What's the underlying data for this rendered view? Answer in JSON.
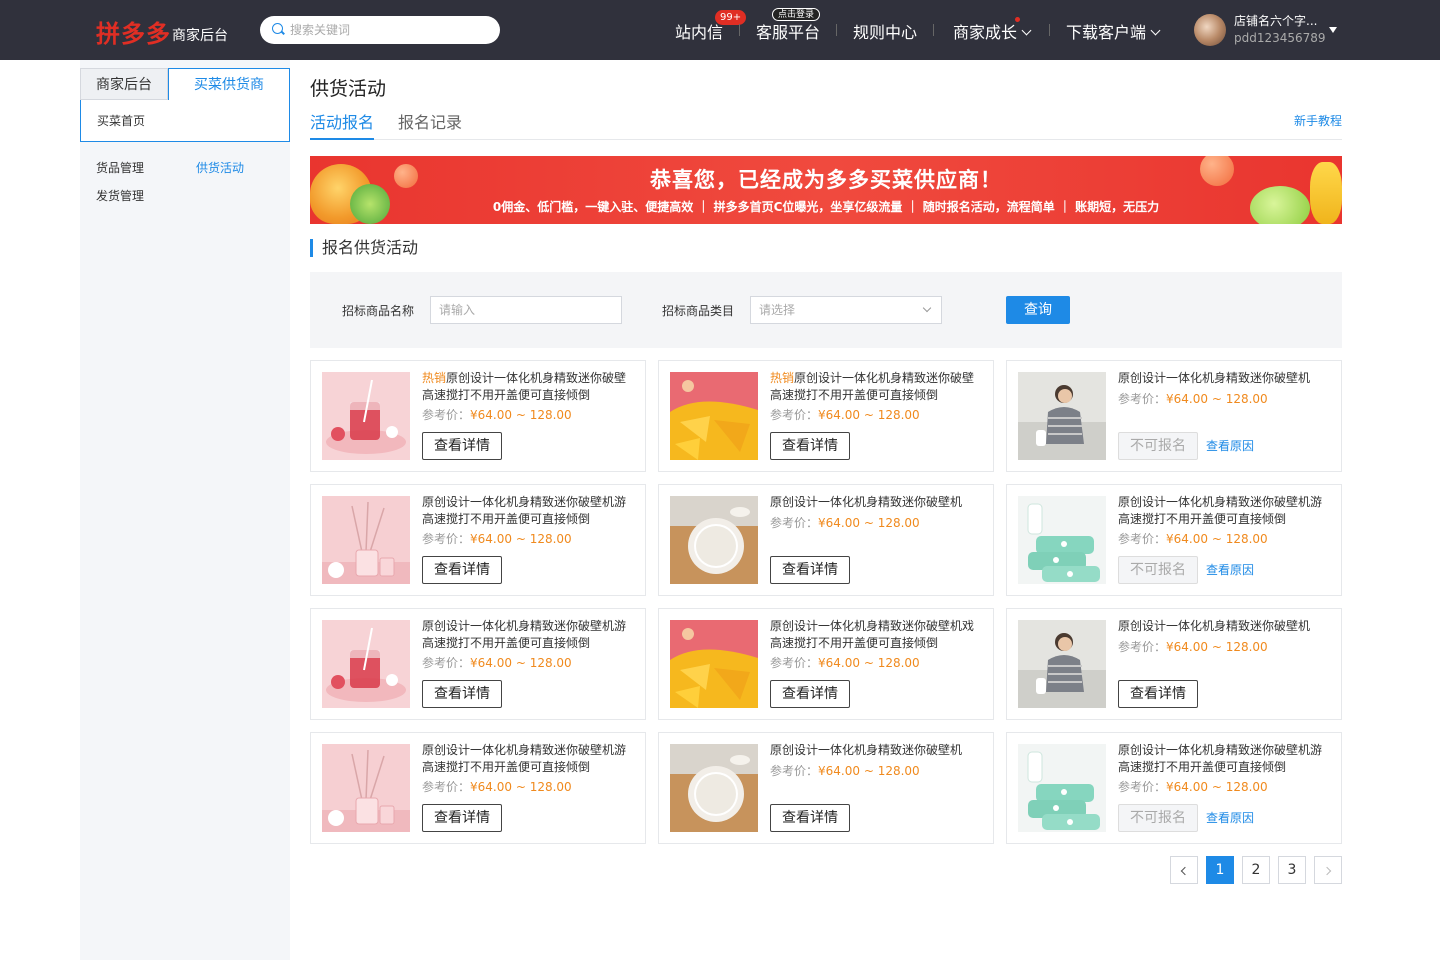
{
  "header": {
    "logo_brand": "拼多多",
    "logo_sub": "商家后台",
    "search_placeholder": "搜索关键词",
    "nav": {
      "messages": "站内信",
      "messages_badge": "99+",
      "service": "客服平台",
      "service_badge": "点击登录",
      "rules": "规则中心",
      "growth": "商家成长",
      "download": "下载客户端"
    },
    "shop_name": "店铺名六个字...",
    "shop_id": "pdd123456789"
  },
  "sidebar": {
    "tab_merchant": "商家后台",
    "tab_supplier": "买菜供货商",
    "home": "买菜首页",
    "goods": "货品管理",
    "supply_activity": "供货活动",
    "shipping": "发货管理"
  },
  "main": {
    "page_title": "供货活动",
    "tab_signup": "活动报名",
    "tab_records": "报名记录",
    "tutorial": "新手教程",
    "banner_title": "恭喜您，已经成为多多买菜供应商！",
    "banner_sub": "0佣金、低门槛，一键入驻、便捷高效 ｜ 拼多多首页C位曝光，坐享亿级流量 ｜ 随时报名活动，流程简单 ｜ 账期短，无压力",
    "section_title": "报名供货活动",
    "filter": {
      "name_label": "招标商品名称",
      "name_placeholder": "请输入",
      "category_label": "招标商品类目",
      "category_placeholder": "请选择",
      "query": "查询"
    },
    "price_label": "参考价：",
    "hot_tag": "热销",
    "detail_label": "查看详情",
    "disabled_label": "不可报名",
    "reason_label": "查看原因",
    "cards": [
      {
        "title": "原创设计一体化机身精致迷你破壁高速搅打不用开盖便可直接倾倒",
        "hot": true,
        "price": "¥64.00 ~ 128.00",
        "img": "drink",
        "action": "detail"
      },
      {
        "title": "原创设计一体化机身精致迷你破壁高速搅打不用开盖便可直接倾倒",
        "hot": true,
        "price": "¥64.00 ~ 128.00",
        "img": "mango",
        "action": "detail"
      },
      {
        "title": "原创设计一体化机身精致迷你破壁机",
        "hot": false,
        "price": "¥64.00 ~ 128.00",
        "img": "woman",
        "action": "disabled"
      },
      {
        "title": "原创设计一体化机身精致迷你破壁机游高速搅打不用开盖便可直接倾倒",
        "hot": false,
        "price": "¥64.00 ~ 128.00",
        "img": "diffuser",
        "action": "detail"
      },
      {
        "title": "原创设计一体化机身精致迷你破壁机",
        "hot": false,
        "price": "¥64.00 ~ 128.00",
        "img": "rice",
        "action": "detail"
      },
      {
        "title": "原创设计一体化机身精致迷你破壁机游高速搅打不用开盖便可直接倾倒",
        "hot": false,
        "price": "¥64.00 ~ 128.00",
        "img": "wipes",
        "action": "disabled"
      },
      {
        "title": "原创设计一体化机身精致迷你破壁机游高速搅打不用开盖便可直接倾倒",
        "hot": false,
        "price": "¥64.00 ~ 128.00",
        "img": "drink",
        "action": "detail"
      },
      {
        "title": "原创设计一体化机身精致迷你破壁机戏高速搅打不用开盖便可直接倾倒",
        "hot": false,
        "price": "¥64.00 ~ 128.00",
        "img": "mango",
        "action": "detail"
      },
      {
        "title": "原创设计一体化机身精致迷你破壁机",
        "hot": false,
        "price": "¥64.00 ~ 128.00",
        "img": "woman",
        "action": "detail"
      },
      {
        "title": "原创设计一体化机身精致迷你破壁机游高速搅打不用开盖便可直接倾倒",
        "hot": false,
        "price": "¥64.00 ~ 128.00",
        "img": "diffuser",
        "action": "detail"
      },
      {
        "title": "原创设计一体化机身精致迷你破壁机",
        "hot": false,
        "price": "¥64.00 ~ 128.00",
        "img": "rice",
        "action": "detail"
      },
      {
        "title": "原创设计一体化机身精致迷你破壁机游高速搅打不用开盖便可直接倾倒",
        "hot": false,
        "price": "¥64.00 ~ 128.00",
        "img": "wipes",
        "action": "disabled"
      }
    ],
    "pagination": {
      "pages": [
        "1",
        "2",
        "3"
      ],
      "current": "1"
    }
  },
  "colors": {
    "accent": "#1e8ae6",
    "brand": "#e02e24",
    "price": "#f08a1e",
    "topbar": "#30313c"
  }
}
